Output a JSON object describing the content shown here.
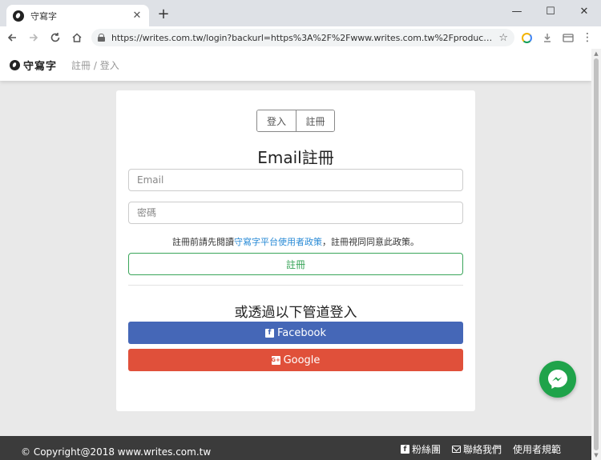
{
  "browser": {
    "tab_title": "守寫字",
    "tab_close": "✕",
    "new_tab": "+",
    "url": "https://writes.com.tw/login?backurl=https%3A%2F%2Fwww.writes.com.tw%2Fproduct%2Fcre...",
    "window_controls": {
      "minimize": "—",
      "maximize": "☐",
      "close": "✕"
    }
  },
  "site": {
    "logo_text": "守寫字",
    "nav_link": "註冊 / 登入"
  },
  "auth": {
    "tabs": [
      "登入",
      "註冊"
    ],
    "title": "Email註冊",
    "email_placeholder": "Email",
    "password_placeholder": "密碼",
    "terms_prefix": "註冊前請先閱讀",
    "terms_link": "守寫字平台使用者政策",
    "terms_suffix": "，註冊視同同意此政策。",
    "submit_label": "註冊",
    "alt_title": "或透過以下管道登入",
    "facebook_label": "Facebook",
    "google_label": "Google"
  },
  "footer": {
    "copyright": "© Copyright@2018 www.writes.com.tw",
    "links": [
      "粉絲團",
      "聯絡我們",
      "使用者規範"
    ]
  },
  "colors": {
    "facebook": "#4567b7",
    "google": "#e0503a",
    "submit": "#3aa55a",
    "link": "#2a8bd6",
    "messenger": "#1fa34a",
    "footer_bg": "#3b3b3b"
  },
  "icons": {
    "back": "arrow-left-icon",
    "forward": "arrow-right-icon",
    "reload": "reload-icon",
    "home": "home-icon",
    "lock": "lock-icon",
    "star": "star-icon",
    "menu": "more-vertical-icon",
    "messenger": "messenger-icon"
  }
}
